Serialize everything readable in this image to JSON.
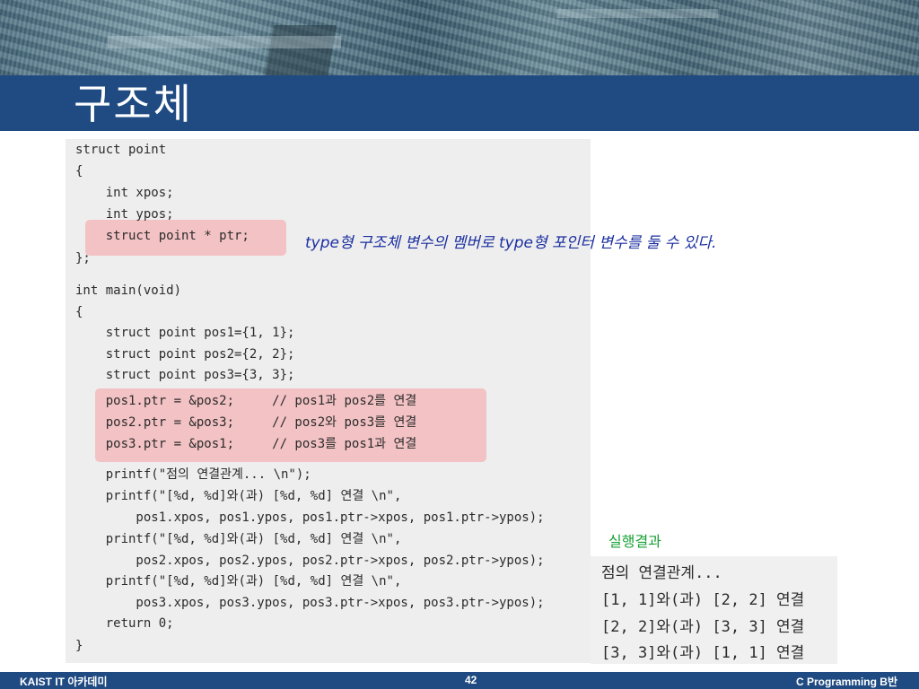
{
  "slide": {
    "title": "구조체",
    "note": "type형 구조체 변수의 멤버로 type형 포인터 변수를 둘 수 있다.",
    "result_label": "실행결과"
  },
  "code_lines": [
    "struct point",
    "{",
    "    int xpos;",
    "    int ypos;",
    "    struct point * ptr;",
    "};",
    "int main(void)",
    "{",
    "    struct point pos1={1, 1};",
    "    struct point pos2={2, 2};",
    "    struct point pos3={3, 3};",
    "    pos1.ptr = &pos2;     // pos1과 pos2를 연결",
    "    pos2.ptr = &pos3;     // pos2와 pos3를 연결",
    "    pos3.ptr = &pos1;     // pos3를 pos1과 연결",
    "    printf(\"점의 연결관계... \\n\");",
    "    printf(\"[%d, %d]와(과) [%d, %d] 연결 \\n\",",
    "        pos1.xpos, pos1.ypos, pos1.ptr->xpos, pos1.ptr->ypos);",
    "    printf(\"[%d, %d]와(과) [%d, %d] 연결 \\n\",",
    "        pos2.xpos, pos2.ypos, pos2.ptr->xpos, pos2.ptr->ypos);",
    "    printf(\"[%d, %d]와(과) [%d, %d] 연결 \\n\",",
    "        pos3.xpos, pos3.ypos, pos3.ptr->xpos, pos3.ptr->ypos);",
    "    return 0;",
    "}"
  ],
  "output_lines": [
    "점의 연결관계...",
    "[1, 1]와(과) [2, 2] 연결",
    "[2, 2]와(과) [3, 3] 연결",
    "[3, 3]와(과) [1, 1] 연결"
  ],
  "footer": {
    "left": "KAIST IT 아카데미",
    "page_number": "42",
    "right": "C Programming B반"
  },
  "colors": {
    "title_bar": "#1f4b82",
    "highlight": "#f3c2c4",
    "note": "#1b2fa0",
    "result_label": "#16a034"
  }
}
